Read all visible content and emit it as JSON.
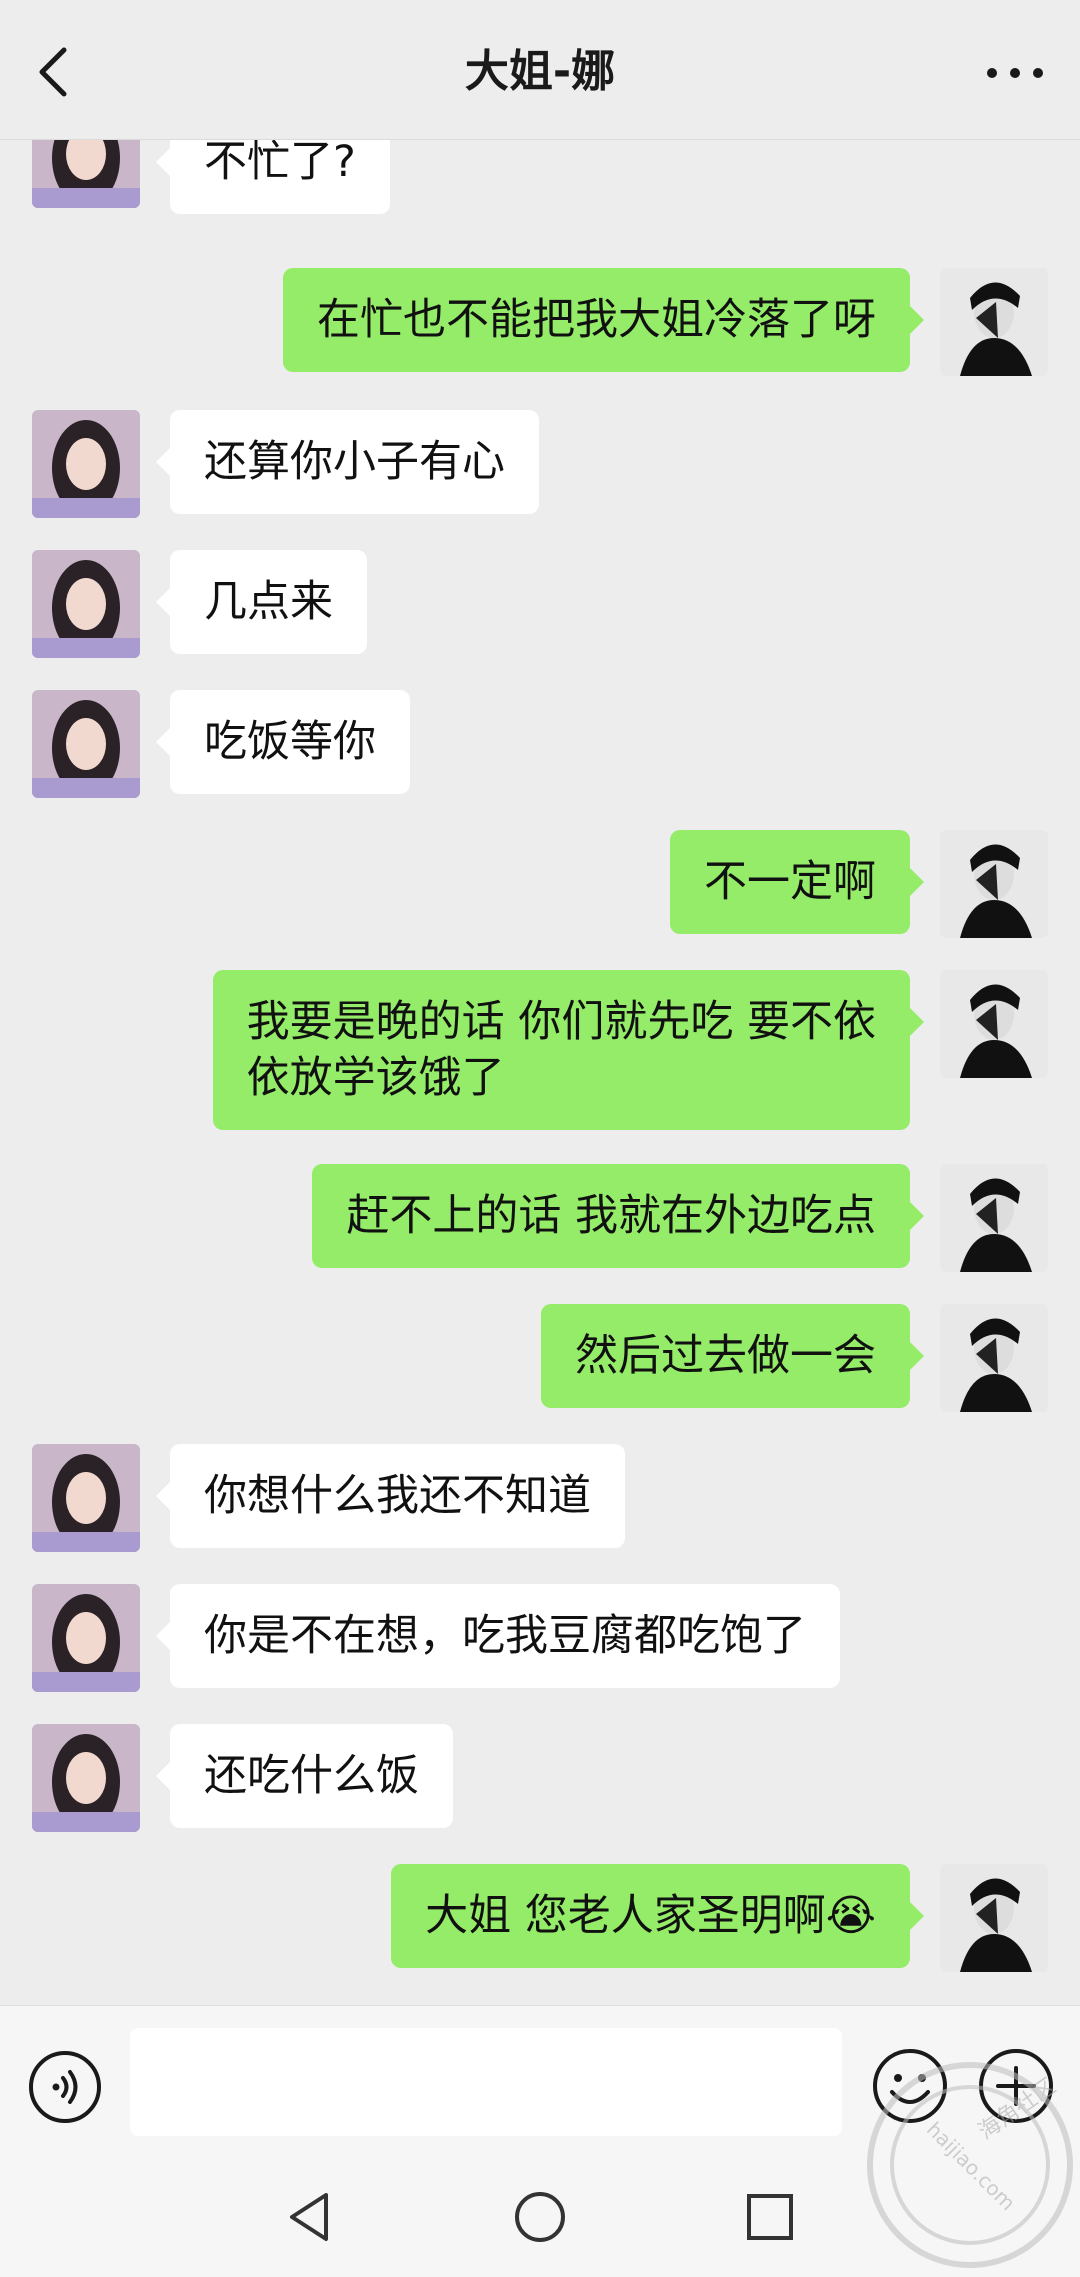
{
  "header": {
    "title": "大姐-娜",
    "back_icon": "chevron-left-icon",
    "more_icon": "ellipsis-icon"
  },
  "colors": {
    "background": "#ededed",
    "outgoing_bubble": "#95ec69",
    "incoming_bubble": "#ffffff"
  },
  "messages": [
    {
      "side": "in",
      "text": "不忙了?"
    },
    {
      "side": "out",
      "text": "在忙也不能把我大姐冷落了呀"
    },
    {
      "side": "in",
      "text": "还算你小子有心"
    },
    {
      "side": "in",
      "text": "几点来"
    },
    {
      "side": "in",
      "text": "吃饭等你"
    },
    {
      "side": "out",
      "text": "不一定啊"
    },
    {
      "side": "out",
      "text": "我要是晚的话 你们就先吃 要不依\n依放学该饿了"
    },
    {
      "side": "out",
      "text": "赶不上的话 我就在外边吃点"
    },
    {
      "side": "out",
      "text": "然后过去做一会"
    },
    {
      "side": "in",
      "text": "你想什么我还不知道"
    },
    {
      "side": "in",
      "text": "你是不在想，吃我豆腐都吃饱了"
    },
    {
      "side": "in",
      "text": "还吃什么饭"
    },
    {
      "side": "out",
      "text": "大姐 您老人家圣明啊😭"
    }
  ],
  "input": {
    "value": "",
    "voice_icon": "voice-icon",
    "emoji_icon": "emoji-icon",
    "plus_icon": "plus-icon"
  },
  "nav": {
    "back_icon": "triangle-back-icon",
    "home_icon": "circle-home-icon",
    "recent_icon": "square-recent-icon"
  },
  "watermark": {
    "text_top": "海角社区",
    "text_bottom": "haijiao.com"
  }
}
